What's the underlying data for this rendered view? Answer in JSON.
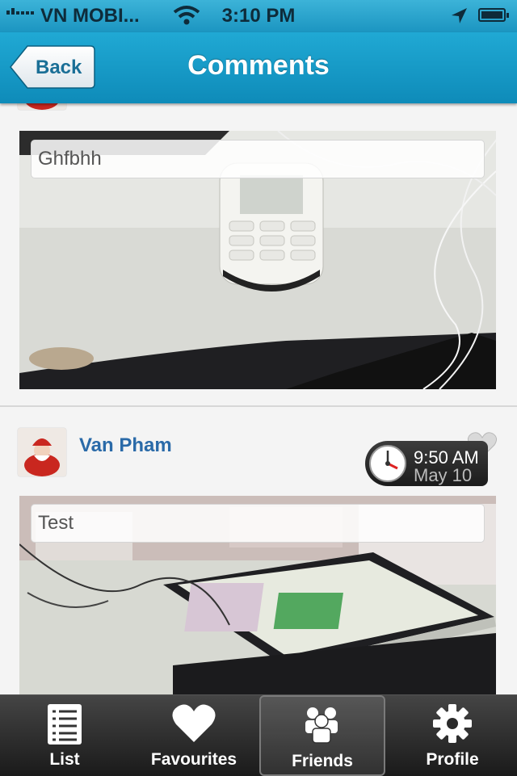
{
  "status_bar": {
    "carrier": "VN MOBI...",
    "time": "3:10 PM"
  },
  "nav": {
    "back_label": "Back",
    "title": "Comments"
  },
  "posts": [
    {
      "caption": "Ghfbhh"
    },
    {
      "user": "Van Pham",
      "time": "9:50 AM",
      "date": "May 10",
      "caption": "Test"
    }
  ],
  "tabs": [
    {
      "label": "List",
      "icon": "list-icon"
    },
    {
      "label": "Favourites",
      "icon": "heart-icon"
    },
    {
      "label": "Friends",
      "icon": "friends-icon",
      "active": true
    },
    {
      "label": "Profile",
      "icon": "gear-icon"
    }
  ]
}
